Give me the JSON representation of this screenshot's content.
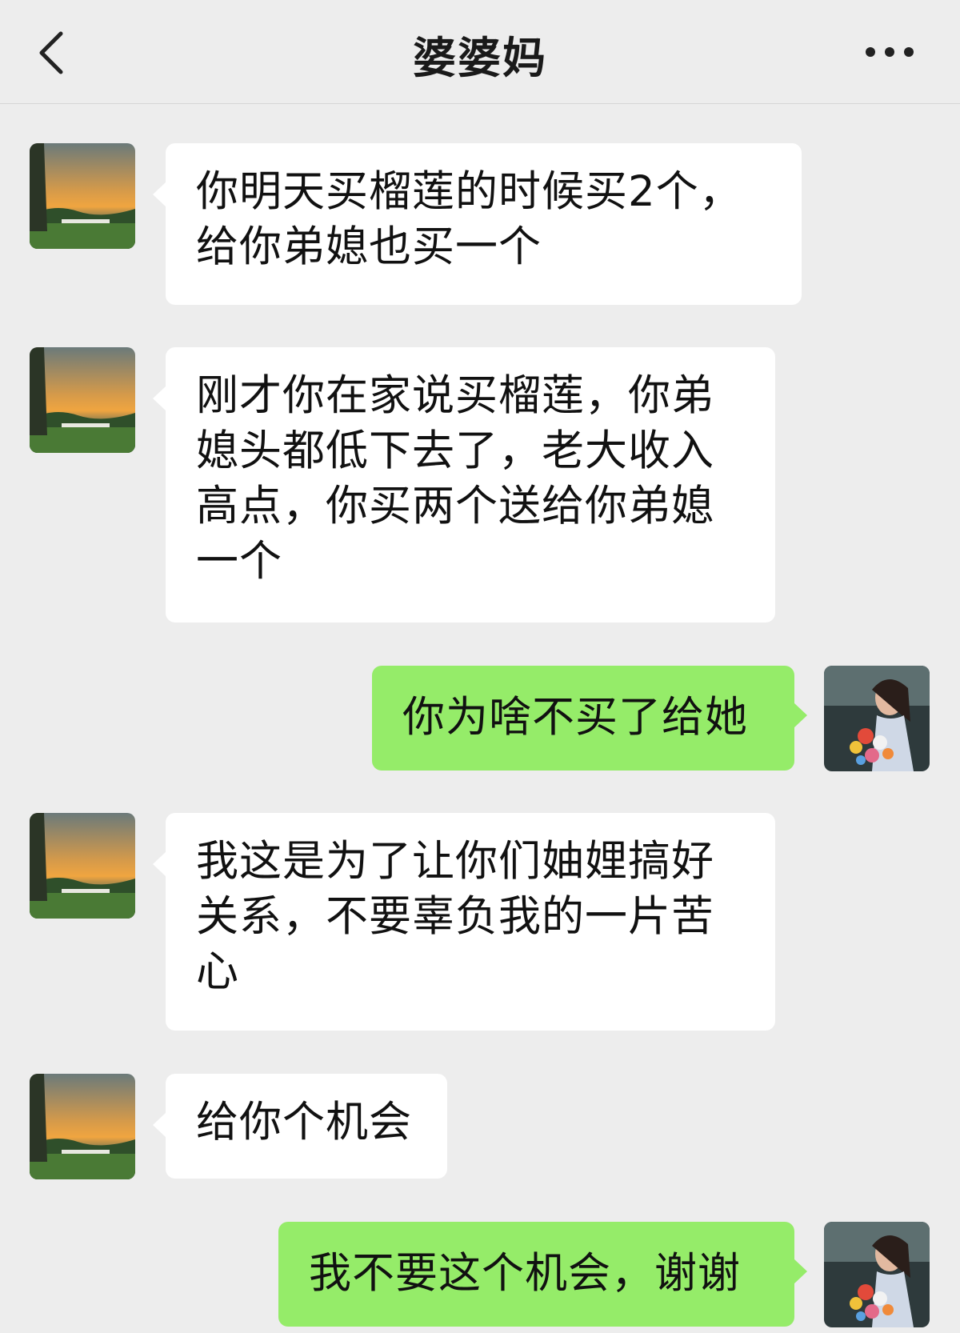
{
  "header": {
    "title": "婆婆妈",
    "back_icon": "chevron-left-icon",
    "more_icon": "more-dots-icon"
  },
  "messages": [
    {
      "sender": "mom",
      "text": "你明天买榴莲的时候买2个，给你弟媳也买一个"
    },
    {
      "sender": "mom",
      "text": "刚才你在家说买榴莲，你弟媳头都低下去了，老大收入高点，你买两个送给你弟媳一个"
    },
    {
      "sender": "me",
      "text": "你为啥不买了给她"
    },
    {
      "sender": "mom",
      "text": "我这是为了让你们妯娌搞好关系，不要辜负我的一片苦心"
    },
    {
      "sender": "mom",
      "text": "给你个机会"
    },
    {
      "sender": "me",
      "text": "我不要这个机会，谢谢"
    }
  ],
  "colors": {
    "background": "#ededed",
    "incoming_bubble": "#ffffff",
    "outgoing_bubble": "#95ec69",
    "text": "#111111"
  }
}
